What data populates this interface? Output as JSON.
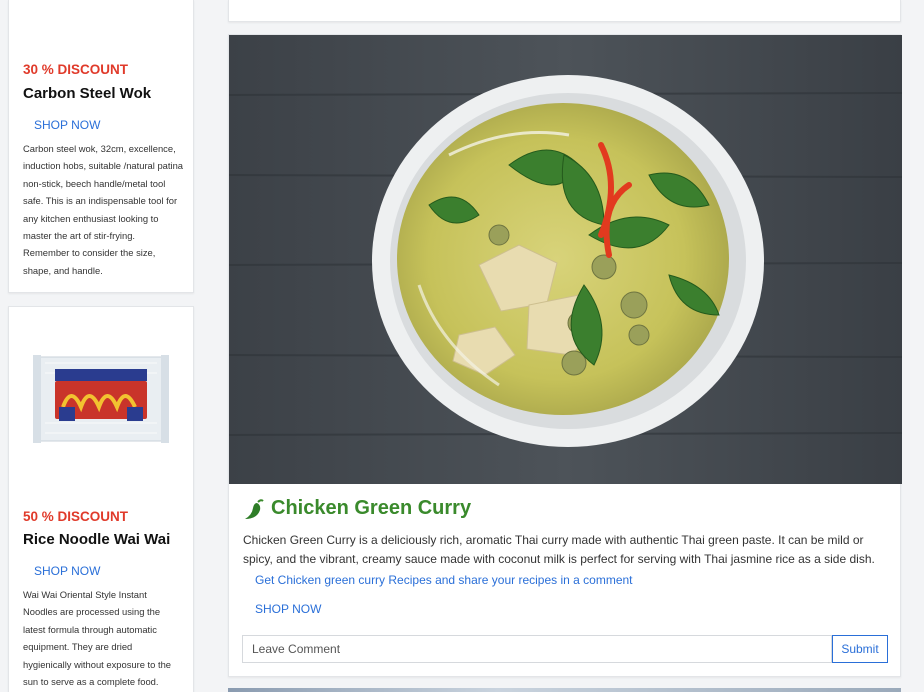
{
  "sidebar": {
    "cards": [
      {
        "discount": "30 % DISCOUNT",
        "title": "Carbon Steel Wok",
        "shop_label": "SHOP NOW",
        "description": "Carbon steel wok, 32cm, excellence, induction hobs, suitable /natural patina non-stick, beech handle/metal tool safe. This is an indispensable tool for any kitchen enthusiast looking to master the art of stir-frying. Remember to consider the size, shape, and handle."
      },
      {
        "discount": "50 % DISCOUNT",
        "title": "Rice Noodle Wai Wai",
        "shop_label": "SHOP NOW",
        "description": "Wai Wai Oriental Style Instant Noodles are processed using the latest formula through automatic equipment. They are dried hygienically without exposure to the sun to serve as a complete food."
      }
    ]
  },
  "post": {
    "title": "Chicken Green Curry",
    "title_icon": "chili-pepper-icon",
    "body": "Chicken Green Curry is a deliciously rich, aromatic Thai curry made with authentic Thai green paste. It can be mild or spicy, and the vibrant, creamy sauce made with coconut milk is perfect for serving with Thai jasmine rice as a side dish.",
    "recipe_link": "Get Chicken green curry Recipes and share your recipes in a comment",
    "shop_label": "SHOP NOW",
    "comment_placeholder": "Leave Comment",
    "submit_label": "Submit"
  },
  "colors": {
    "discount": "#e03a2a",
    "link": "#2a6fd8",
    "title_green": "#3a8a2c",
    "page_bg": "#f3f4f6"
  }
}
